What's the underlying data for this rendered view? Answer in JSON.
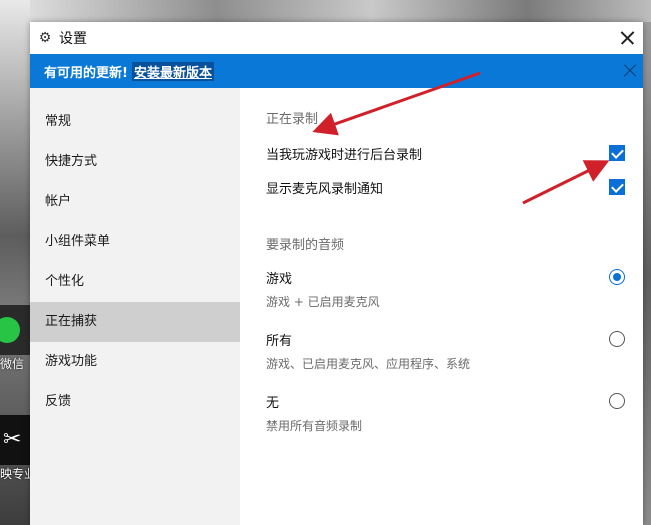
{
  "window": {
    "title": "设置",
    "gear_icon": "gear-icon",
    "close_icon": "close-icon"
  },
  "banner": {
    "text": "有可用的更新!",
    "link": "安装最新版本",
    "color": "#0a78d7"
  },
  "sidebar": {
    "items": [
      {
        "label": "常规"
      },
      {
        "label": "快捷方式"
      },
      {
        "label": "帐户"
      },
      {
        "label": "小组件菜单"
      },
      {
        "label": "个性化"
      },
      {
        "label": "正在捕获",
        "active": true
      },
      {
        "label": "游戏功能"
      },
      {
        "label": "反馈"
      }
    ]
  },
  "recording": {
    "section_title": "正在录制",
    "background_record": {
      "label": "当我玩游戏时进行后台录制",
      "checked": true
    },
    "mic_notify": {
      "label": "显示麦克风录制通知",
      "checked": true
    }
  },
  "audio": {
    "section_title": "要录制的音频",
    "options": [
      {
        "title": "游戏",
        "subtitle": "游戏 + 已启用麦克风",
        "selected": true
      },
      {
        "title": "所有",
        "subtitle": "游戏、已启用麦克风、应用程序、系统",
        "selected": false
      },
      {
        "title": "无",
        "subtitle": "禁用所有音频录制",
        "selected": false
      }
    ]
  },
  "desktop": {
    "icons": [
      {
        "label": "微信",
        "icon": "wechat-icon"
      },
      {
        "label": "映专业",
        "icon": "capcut-icon"
      }
    ]
  },
  "annotation_color": "#d0202a"
}
